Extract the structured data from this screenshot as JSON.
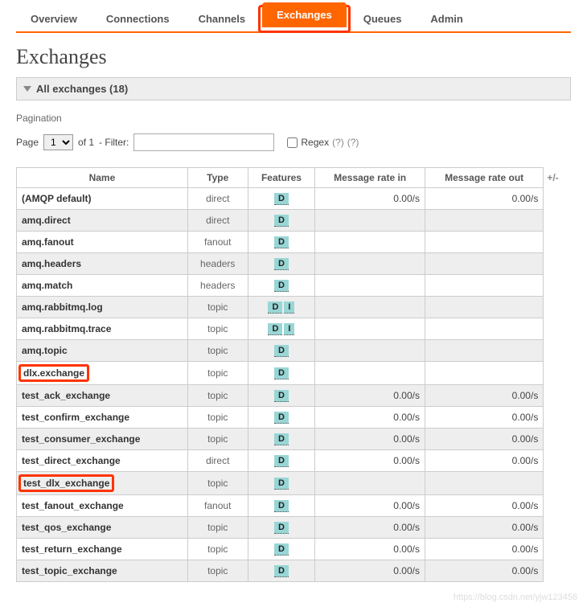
{
  "nav": {
    "items": [
      {
        "label": "Overview"
      },
      {
        "label": "Connections"
      },
      {
        "label": "Channels"
      },
      {
        "label": "Exchanges"
      },
      {
        "label": "Queues"
      },
      {
        "label": "Admin"
      }
    ],
    "active_index": 3
  },
  "page_title": "Exchanges",
  "section_header": "All exchanges (18)",
  "pagination": {
    "label": "Pagination",
    "page_label": "Page",
    "page_value": "1",
    "of_text": "of 1",
    "filter_label": "- Filter:",
    "filter_value": "",
    "regex_label": "Regex",
    "help1": "(?)",
    "help2": "(?)"
  },
  "table": {
    "headers": {
      "name": "Name",
      "type": "Type",
      "features": "Features",
      "rate_in": "Message rate in",
      "rate_out": "Message rate out",
      "plusminus": "+/-"
    },
    "rows": [
      {
        "name": "(AMQP default)",
        "type": "direct",
        "features": [
          "D"
        ],
        "rate_in": "0.00/s",
        "rate_out": "0.00/s",
        "highlight": false
      },
      {
        "name": "amq.direct",
        "type": "direct",
        "features": [
          "D"
        ],
        "rate_in": "",
        "rate_out": "",
        "highlight": false
      },
      {
        "name": "amq.fanout",
        "type": "fanout",
        "features": [
          "D"
        ],
        "rate_in": "",
        "rate_out": "",
        "highlight": false
      },
      {
        "name": "amq.headers",
        "type": "headers",
        "features": [
          "D"
        ],
        "rate_in": "",
        "rate_out": "",
        "highlight": false
      },
      {
        "name": "amq.match",
        "type": "headers",
        "features": [
          "D"
        ],
        "rate_in": "",
        "rate_out": "",
        "highlight": false
      },
      {
        "name": "amq.rabbitmq.log",
        "type": "topic",
        "features": [
          "D",
          "I"
        ],
        "rate_in": "",
        "rate_out": "",
        "highlight": false
      },
      {
        "name": "amq.rabbitmq.trace",
        "type": "topic",
        "features": [
          "D",
          "I"
        ],
        "rate_in": "",
        "rate_out": "",
        "highlight": false
      },
      {
        "name": "amq.topic",
        "type": "topic",
        "features": [
          "D"
        ],
        "rate_in": "",
        "rate_out": "",
        "highlight": false
      },
      {
        "name": "dlx.exchange",
        "type": "topic",
        "features": [
          "D"
        ],
        "rate_in": "",
        "rate_out": "",
        "highlight": true
      },
      {
        "name": "test_ack_exchange",
        "type": "topic",
        "features": [
          "D"
        ],
        "rate_in": "0.00/s",
        "rate_out": "0.00/s",
        "highlight": false
      },
      {
        "name": "test_confirm_exchange",
        "type": "topic",
        "features": [
          "D"
        ],
        "rate_in": "0.00/s",
        "rate_out": "0.00/s",
        "highlight": false
      },
      {
        "name": "test_consumer_exchange",
        "type": "topic",
        "features": [
          "D"
        ],
        "rate_in": "0.00/s",
        "rate_out": "0.00/s",
        "highlight": false
      },
      {
        "name": "test_direct_exchange",
        "type": "direct",
        "features": [
          "D"
        ],
        "rate_in": "0.00/s",
        "rate_out": "0.00/s",
        "highlight": false
      },
      {
        "name": "test_dlx_exchange",
        "type": "topic",
        "features": [
          "D"
        ],
        "rate_in": "",
        "rate_out": "",
        "highlight": true
      },
      {
        "name": "test_fanout_exchange",
        "type": "fanout",
        "features": [
          "D"
        ],
        "rate_in": "0.00/s",
        "rate_out": "0.00/s",
        "highlight": false
      },
      {
        "name": "test_qos_exchange",
        "type": "topic",
        "features": [
          "D"
        ],
        "rate_in": "0.00/s",
        "rate_out": "0.00/s",
        "highlight": false
      },
      {
        "name": "test_return_exchange",
        "type": "topic",
        "features": [
          "D"
        ],
        "rate_in": "0.00/s",
        "rate_out": "0.00/s",
        "highlight": false
      },
      {
        "name": "test_topic_exchange",
        "type": "topic",
        "features": [
          "D"
        ],
        "rate_in": "0.00/s",
        "rate_out": "0.00/s",
        "highlight": false
      }
    ]
  },
  "watermark": "https://blog.csdn.net/yjw123456"
}
